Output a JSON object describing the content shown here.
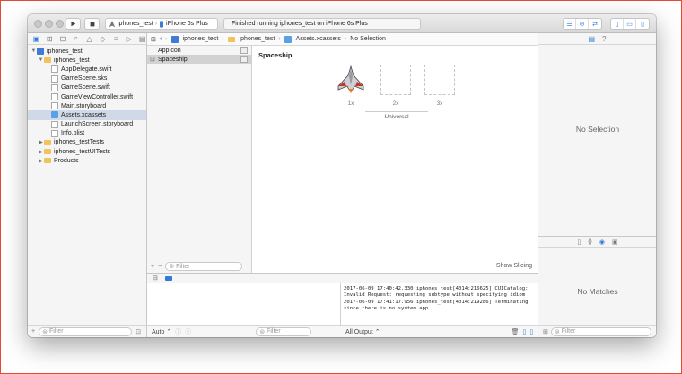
{
  "toolbar": {
    "scheme_target": "iphones_test",
    "scheme_device": "iPhone 6s Plus",
    "status_text": "Finished running iphones_test on iPhone 6s Plus"
  },
  "navigator": {
    "items": [
      {
        "label": "iphones_test",
        "level": 0,
        "kind": "proj",
        "disclosure": "open"
      },
      {
        "label": "iphones_test",
        "level": 1,
        "kind": "folder",
        "disclosure": "open"
      },
      {
        "label": "AppDelegate.swift",
        "level": 2,
        "kind": "file"
      },
      {
        "label": "GameScene.sks",
        "level": 2,
        "kind": "file"
      },
      {
        "label": "GameScene.swift",
        "level": 2,
        "kind": "file"
      },
      {
        "label": "GameViewController.swift",
        "level": 2,
        "kind": "file"
      },
      {
        "label": "Main.storyboard",
        "level": 2,
        "kind": "file"
      },
      {
        "label": "Assets.xcassets",
        "level": 2,
        "kind": "assets",
        "selected": true
      },
      {
        "label": "LaunchScreen.storyboard",
        "level": 2,
        "kind": "file"
      },
      {
        "label": "Info.plist",
        "level": 2,
        "kind": "file"
      },
      {
        "label": "iphones_testTests",
        "level": 1,
        "kind": "folder",
        "disclosure": "closed"
      },
      {
        "label": "iphones_testUITests",
        "level": 1,
        "kind": "folder",
        "disclosure": "closed"
      },
      {
        "label": "Products",
        "level": 1,
        "kind": "folder",
        "disclosure": "closed"
      }
    ],
    "filter_placeholder": "Filter"
  },
  "jumpbar": {
    "crumbs": [
      "iphones_test",
      "iphones_test",
      "Assets.xcassets",
      "No Selection"
    ]
  },
  "assets": {
    "items": [
      {
        "label": "AppIcon",
        "selected": false
      },
      {
        "label": "Spaceship",
        "selected": true
      }
    ],
    "filter_placeholder": "Filter"
  },
  "canvas": {
    "title": "Spaceship",
    "slots": [
      "1x",
      "2x",
      "3x"
    ],
    "group_label": "Universal",
    "show_slicing": "Show Slicing"
  },
  "debug": {
    "auto_label": "Auto",
    "vars_filter_placeholder": "Filter",
    "output_label": "All Output",
    "console_filter_placeholder": "Filter",
    "console_lines": [
      "2017-06-09 17:40:42.330 iphones_test[4014:216625] CUICatalog:",
      "Invalid Request: requesting subtype without specifying idiom",
      "2017-06-09 17:41:17.956 iphones_test[4014:219286] Terminating",
      "since there is no system app."
    ]
  },
  "inspector": {
    "no_selection": "No Selection",
    "no_matches": "No Matches",
    "filter_placeholder": "Filter"
  }
}
